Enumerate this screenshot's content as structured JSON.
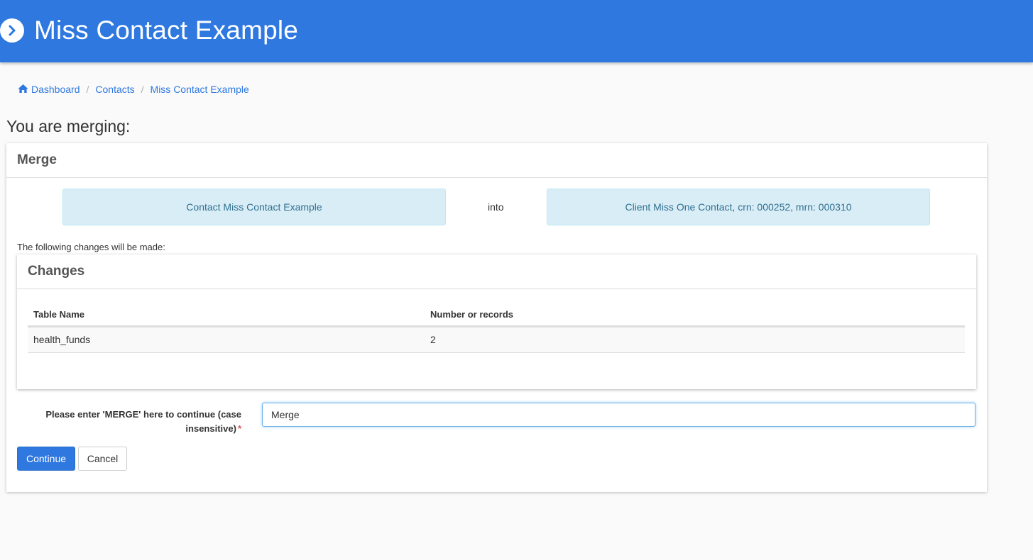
{
  "header": {
    "title": "Miss Contact Example",
    "icon": "chevron-right-circle-icon",
    "color": "#2e78e0"
  },
  "breadcrumb": {
    "items": [
      {
        "label": "Dashboard",
        "icon": "home-icon"
      },
      {
        "label": "Contacts"
      },
      {
        "label": "Miss Contact Example"
      }
    ],
    "separator": "/"
  },
  "page": {
    "heading": "You are merging:"
  },
  "merge_panel": {
    "title": "Merge",
    "source": "Contact Miss Contact Example",
    "into_label": "into",
    "target": "Client Miss One Contact, crn: 000252, mrn: 000310",
    "changes_intro": "The following changes will be made:"
  },
  "changes_panel": {
    "title": "Changes",
    "columns": [
      "Table Name",
      "Number or records"
    ],
    "rows": [
      [
        "health_funds",
        "2"
      ]
    ]
  },
  "confirm_form": {
    "label": "Please enter 'MERGE' here to continue (case insensitive)",
    "required_mark": "*",
    "input_value": "Merge"
  },
  "buttons": {
    "continue_label": "Continue",
    "cancel_label": "Cancel"
  }
}
